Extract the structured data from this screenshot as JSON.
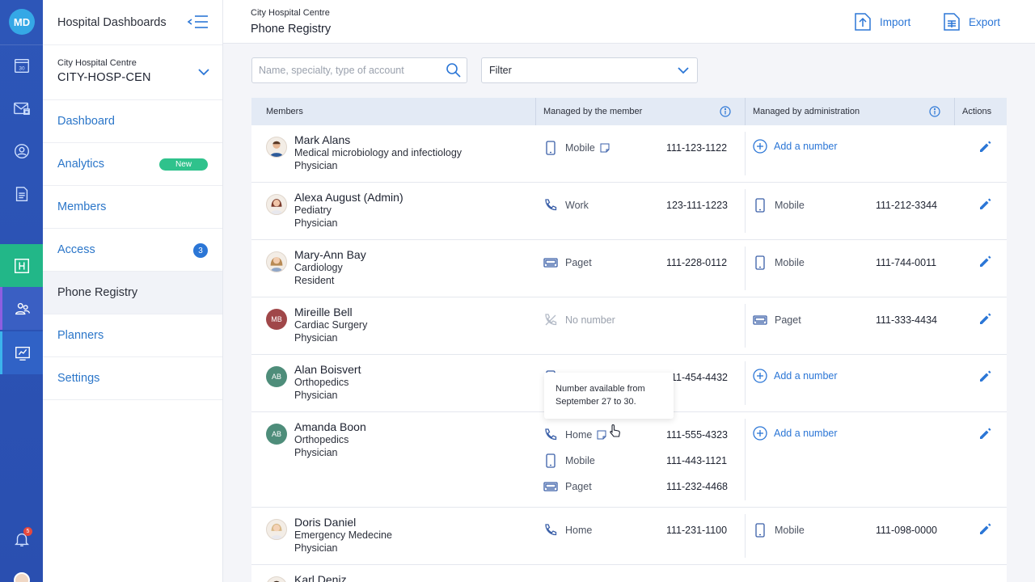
{
  "rail": {
    "logo": "MD",
    "calendar_day": "30",
    "bell_count": "5"
  },
  "sidebar": {
    "title": "Hospital Dashboards",
    "org_name": "City Hospital Centre",
    "org_code": "CITY-HOSP-CEN",
    "items": [
      {
        "label": "Dashboard"
      },
      {
        "label": "Analytics",
        "badge": "New"
      },
      {
        "label": "Members"
      },
      {
        "label": "Access",
        "badge": "3"
      },
      {
        "label": "Phone Registry"
      },
      {
        "label": "Planners"
      },
      {
        "label": "Settings"
      }
    ]
  },
  "header": {
    "breadcrumb": "City Hospital Centre",
    "title": "Phone Registry",
    "import_label": "Import",
    "export_label": "Export"
  },
  "search": {
    "placeholder": "Name, specialty, type of account"
  },
  "filter": {
    "label": "Filter"
  },
  "table": {
    "headers": [
      "Members",
      "Managed by the member",
      "Managed by administration",
      "Actions"
    ],
    "add_label": "Add a number",
    "rows": [
      {
        "name": "Mark Alans",
        "specialty": "Medical microbiology and infectiology",
        "role": "Physician",
        "member_phones": [
          {
            "type": "Mobile",
            "number": "111-123-1122"
          }
        ]
      },
      {
        "name": "Alexa August (Admin)",
        "specialty": "Pediatry",
        "role": "Physician",
        "member_phones": [
          {
            "type": "Work",
            "number": "123-111-1223"
          }
        ],
        "admin_phones": [
          {
            "type": "Mobile",
            "number": "111-212-3344"
          }
        ]
      },
      {
        "name": "Mary-Ann Bay",
        "specialty": "Cardiology",
        "role": "Resident",
        "member_phones": [
          {
            "type": "Paget",
            "number": "111-228-0112"
          }
        ],
        "admin_phones": [
          {
            "type": "Mobile",
            "number": "111-744-0011"
          }
        ]
      },
      {
        "name": "Mireille Bell",
        "initials": "MB",
        "specialty": "Cardiac Surgery",
        "role": "Physician",
        "member_phones": [
          {
            "type": "No number",
            "number": ""
          }
        ],
        "admin_phones": [
          {
            "type": "Paget",
            "number": "111-333-4434"
          }
        ]
      },
      {
        "name": "Alan Boisvert",
        "initials": "AB",
        "specialty": "Orthopedics",
        "role": "Physician",
        "member_phones": [
          {
            "type": "",
            "number": "111-454-4432"
          }
        ]
      },
      {
        "name": "Amanda Boon",
        "initials": "AB",
        "specialty": "Orthopedics",
        "role": "Physician",
        "member_phones": [
          {
            "type": "Home",
            "number": "111-555-4323"
          },
          {
            "type": "Mobile",
            "number": "111-443-1121"
          },
          {
            "type": "Paget",
            "number": "111-232-4468"
          }
        ]
      },
      {
        "name": "Doris Daniel",
        "specialty": "Emergency Medecine",
        "role": "Physician",
        "member_phones": [
          {
            "type": "Home",
            "number": "111-231-1100"
          }
        ],
        "admin_phones": [
          {
            "type": "Mobile",
            "number": "111-098-0000"
          }
        ]
      },
      {
        "name": "Karl Deniz"
      }
    ]
  },
  "tooltip": {
    "text": "Number available from September 27 to 30."
  }
}
